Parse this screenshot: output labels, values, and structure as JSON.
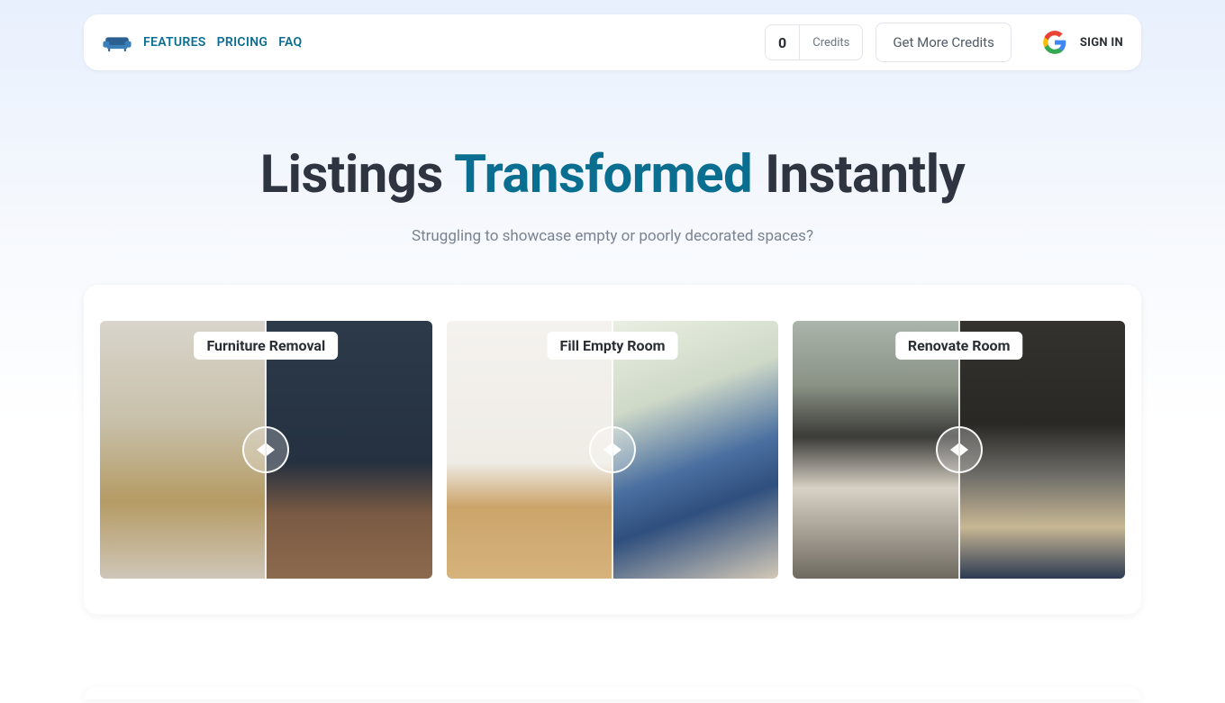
{
  "nav": {
    "features": "FEATURES",
    "pricing": "PRICING",
    "faq": "FAQ"
  },
  "credits": {
    "count": "0",
    "label": "Credits",
    "get_more": "Get More Credits"
  },
  "auth": {
    "signin": "SIGN IN"
  },
  "hero": {
    "title_pre": "Listings ",
    "title_accent": "Transformed",
    "title_post": " Instantly",
    "subtitle": "Struggling to showcase empty or poorly decorated spaces?"
  },
  "cards": [
    {
      "label": "Furniture Removal"
    },
    {
      "label": "Fill Empty Room"
    },
    {
      "label": "Renovate Room"
    }
  ]
}
